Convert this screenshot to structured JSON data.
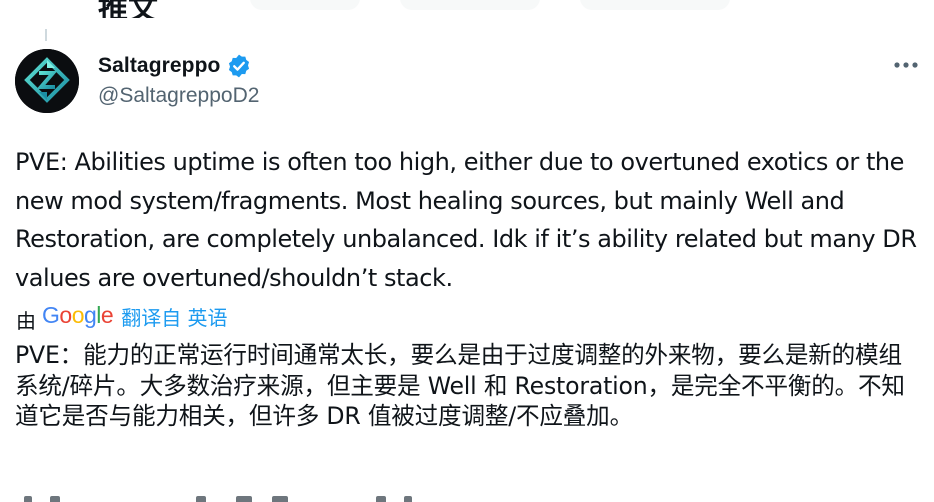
{
  "header_top": {
    "cut_text": "推文"
  },
  "author": {
    "display_name": "Saltagreppo",
    "handle": "@SaltagreppoD2",
    "verified_icon": "verified-badge-icon",
    "avatar_icon": "destiny-logo-avatar"
  },
  "more_button": {
    "label": "···"
  },
  "tweet": {
    "text": "PVE: Abilities uptime is often too high, either due to overtuned exotics or the new mod system/fragments. Most healing sources, but mainly Well and Restoration, are completely unbalanced. Idk if it’s ability related but many DR values are overtuned/shouldn’t stack."
  },
  "translation": {
    "by_label": "由",
    "provider": "Google",
    "link_label": "翻译自 英语",
    "text": "PVE：能力的正常运行时间通常太长，要么是由于过度调整的外来物，要么是新的模组系统/碎片。大多数治疗来源，但主要是 Well 和 Restoration，是完全不平衡的。不知道它是否与能力相关，但许多 DR 值被过度调整/不应叠加。"
  },
  "colors": {
    "text": "#0f1419",
    "secondary": "#536471",
    "accent": "#1d9bf0"
  }
}
